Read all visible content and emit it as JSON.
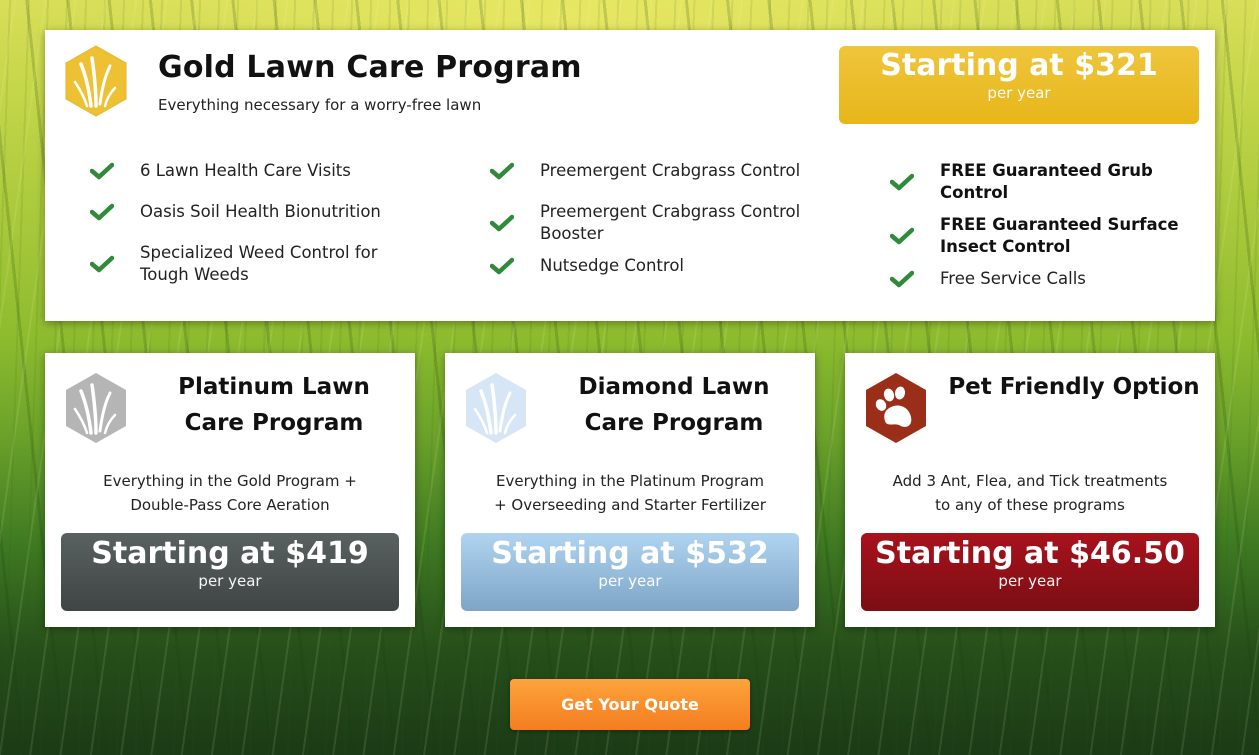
{
  "gold": {
    "icon": "grass-hexagon-icon",
    "icon_color": "#eec134",
    "title": "Gold Lawn Care Program",
    "subtitle": "Everything necessary for a worry-free lawn",
    "price": "Starting at $321",
    "period": "per year",
    "price_color": "#e9b820",
    "features": [
      [
        {
          "text": "6 Lawn Health Care Visits",
          "bold": false
        },
        {
          "text": "Oasis Soil Health Bionutrition",
          "bold": false
        },
        {
          "text": "Specialized Weed Control for Tough Weeds",
          "bold": false
        }
      ],
      [
        {
          "text": "Preemergent Crabgrass Control",
          "bold": false
        },
        {
          "text": "Preemergent Crabgrass Control Booster",
          "bold": false
        },
        {
          "text": "Nutsedge Control",
          "bold": false
        }
      ],
      [
        {
          "text": "FREE Guaranteed Grub Control",
          "bold": true
        },
        {
          "text": "FREE Guaranteed Surface Insect Control",
          "bold": true
        },
        {
          "text": "Free Service Calls",
          "bold": false
        }
      ]
    ],
    "check_icon": "checkmark-icon",
    "check_color": "#2f8a3a"
  },
  "platinum": {
    "icon": "grass-hexagon-icon",
    "icon_color": "#b5b5b5",
    "title": "Platinum Lawn Care Program",
    "desc_line1": "Everything in the Gold Program +",
    "desc_line2": "Double-Pass Core Aeration",
    "price": "Starting at $419",
    "period": "per year",
    "price_color": "#4c5352"
  },
  "diamond": {
    "icon": "grass-hexagon-icon",
    "icon_color": "#d6e6f6",
    "title": "Diamond Lawn Care Program",
    "desc_line1": "Everything in the Platinum Program",
    "desc_line2": "+ Overseeding and Starter Fertilizer",
    "price": "Starting at $532",
    "period": "per year",
    "price_color": "#97bcdc"
  },
  "pet": {
    "icon": "paw-print-hexagon-icon",
    "icon_color": "#9a2e18",
    "title": "Pet Friendly Option",
    "desc_line1": "Add 3 Ant, Flea, and Tick treatments",
    "desc_line2": "to any of these programs",
    "price": "Starting at $46.50",
    "period": "per year",
    "price_color": "#921119"
  },
  "cta": {
    "label": "Get Your Quote",
    "color": "#f88d2a"
  }
}
